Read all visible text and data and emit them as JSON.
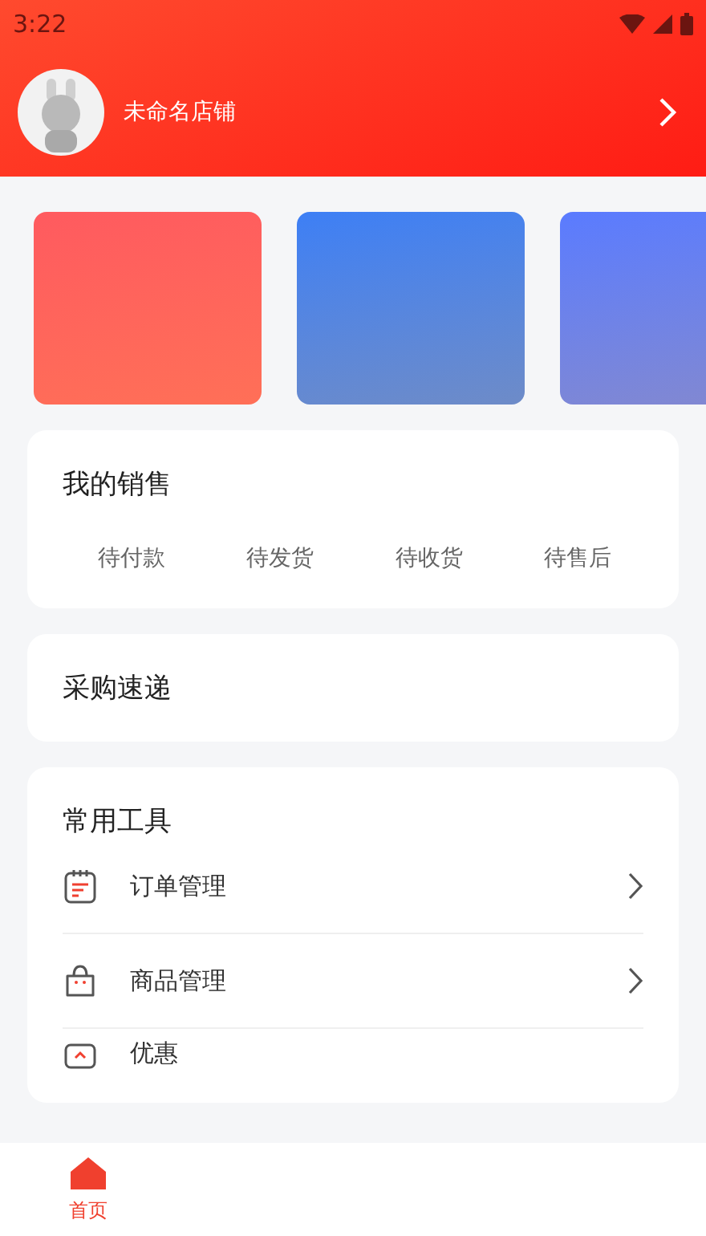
{
  "status_bar": {
    "time": "3:22"
  },
  "shop": {
    "name": "未命名店铺"
  },
  "banners": [
    {
      "color": "#ff5a5f"
    },
    {
      "color": "#3d7ff5"
    },
    {
      "color": "#5a7bff"
    }
  ],
  "sales": {
    "title": "我的销售",
    "items": [
      "待付款",
      "待发货",
      "待收货",
      "待售后"
    ]
  },
  "purchase": {
    "title": "采购速递"
  },
  "tools": {
    "title": "常用工具",
    "items": [
      {
        "kind": "order",
        "label": "订单管理"
      },
      {
        "kind": "goods",
        "label": "商品管理"
      },
      {
        "kind": "coupon",
        "label": "优惠"
      }
    ]
  },
  "nav": [
    {
      "label": "首页",
      "selected": true
    }
  ]
}
